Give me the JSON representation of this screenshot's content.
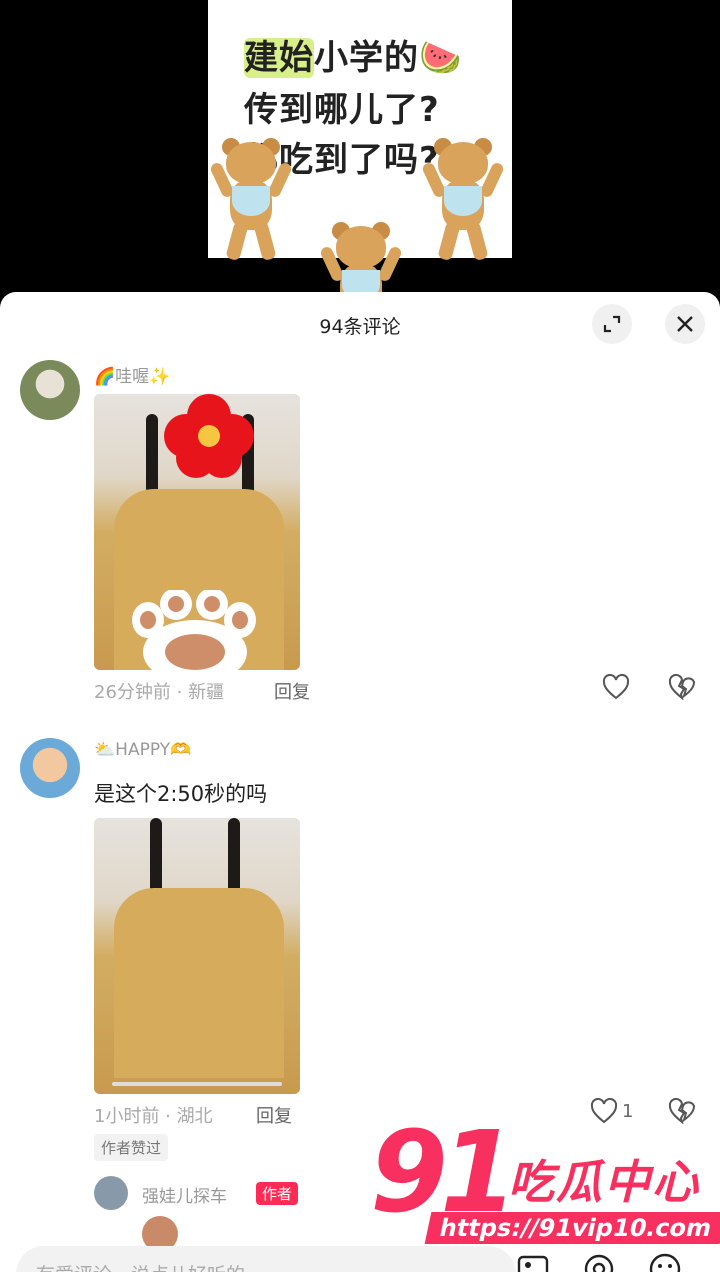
{
  "video": {
    "line1_hl": "建始",
    "line1_rest": "小学的🍉",
    "line2": "传到哪儿了?",
    "line3": "都吃到了吗?"
  },
  "sheet": {
    "title": "94条评论"
  },
  "comments": [
    {
      "username": "🌈哇喔✨",
      "time_location": "26分钟前 · 新疆",
      "reply_label": "回复",
      "likes": ""
    },
    {
      "username": "⛅HAPPY🫶",
      "text": "是这个2:50秒的吗",
      "time_location": "1小时前 · 湖北",
      "reply_label": "回复",
      "likes": "1",
      "badge": "作者赞过"
    }
  ],
  "sub_reply": {
    "username": "强娃儿探车",
    "tag": "作者"
  },
  "input": {
    "placeholder": "有爱评论，说点儿好听的"
  },
  "watermark": {
    "number": "91",
    "brand": "吃瓜中心",
    "url": "https://91vip10.com"
  }
}
